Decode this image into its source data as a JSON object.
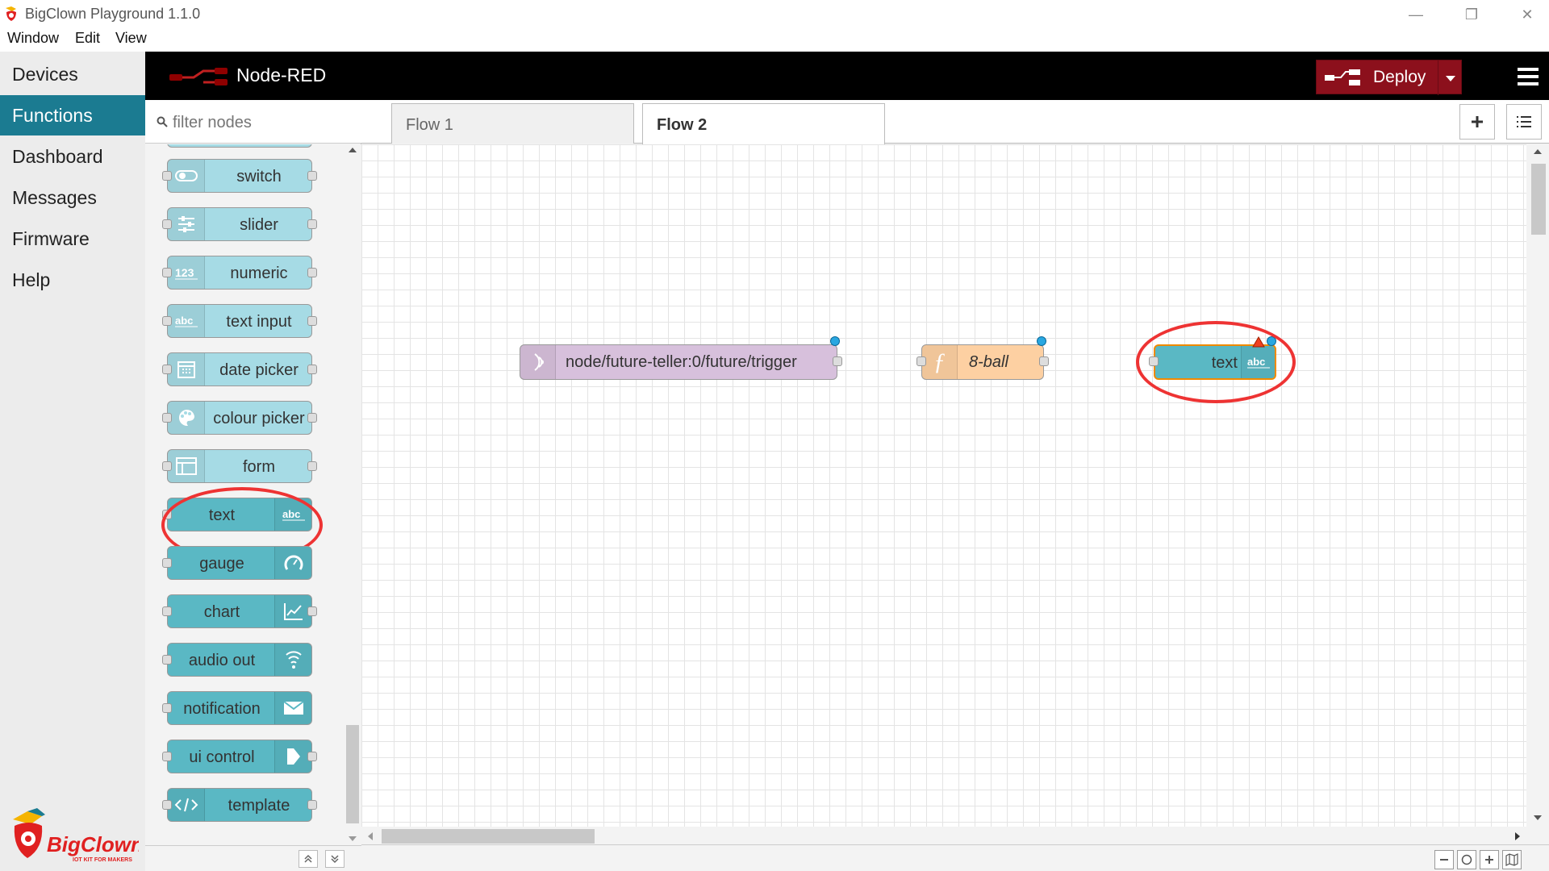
{
  "window": {
    "title": "BigClown Playground 1.1.0",
    "minimize_glyph": "—",
    "restore_glyph": "❐",
    "close_glyph": "✕"
  },
  "menu": [
    "Window",
    "Edit",
    "View"
  ],
  "sidebar": {
    "items": [
      {
        "label": "Devices",
        "active": false
      },
      {
        "label": "Functions",
        "active": true
      },
      {
        "label": "Dashboard",
        "active": false
      },
      {
        "label": "Messages",
        "active": false
      },
      {
        "label": "Firmware",
        "active": false
      },
      {
        "label": "Help",
        "active": false
      }
    ],
    "logo": {
      "brand": "BigClown",
      "tagline": "IOT KIT FOR MAKERS"
    }
  },
  "header": {
    "title": "Node-RED",
    "deploy_label": "Deploy"
  },
  "palette": {
    "filter_placeholder": "filter nodes",
    "nodes": [
      {
        "label": "switch",
        "icon": "toggle-icon"
      },
      {
        "label": "slider",
        "icon": "slider-icon"
      },
      {
        "label": "numeric",
        "icon": "numeric-icon"
      },
      {
        "label": "text input",
        "icon": "abc-icon"
      },
      {
        "label": "date picker",
        "icon": "calendar-icon"
      },
      {
        "label": "colour picker",
        "icon": "palette-icon"
      },
      {
        "label": "form",
        "icon": "form-icon"
      },
      {
        "label": "text",
        "icon": "abc-icon"
      },
      {
        "label": "gauge",
        "icon": "gauge-icon"
      },
      {
        "label": "chart",
        "icon": "chart-icon"
      },
      {
        "label": "audio out",
        "icon": "audio-icon"
      },
      {
        "label": "notification",
        "icon": "envelope-icon"
      },
      {
        "label": "ui control",
        "icon": "arrow-icon"
      },
      {
        "label": "template",
        "icon": "code-icon"
      }
    ]
  },
  "tabs": [
    {
      "label": "Flow 1",
      "active": false
    },
    {
      "label": "Flow 2",
      "active": true
    }
  ],
  "flow": {
    "nodes": [
      {
        "label": "node/future-teller:0/future/trigger",
        "type": "mqtt-in",
        "color": "#d7c0dc"
      },
      {
        "label": "8-ball",
        "type": "function",
        "color": "#fdd0a2"
      },
      {
        "label": "text",
        "type": "ui-text",
        "color": "#5ab8c4"
      }
    ],
    "icon_texts": {
      "function": "ƒ",
      "abc": "abc"
    }
  },
  "colors": {
    "accent": "#1b7b91",
    "deploy": "#8c101c",
    "highlight": "#e33333",
    "status": "#29a7e1"
  }
}
